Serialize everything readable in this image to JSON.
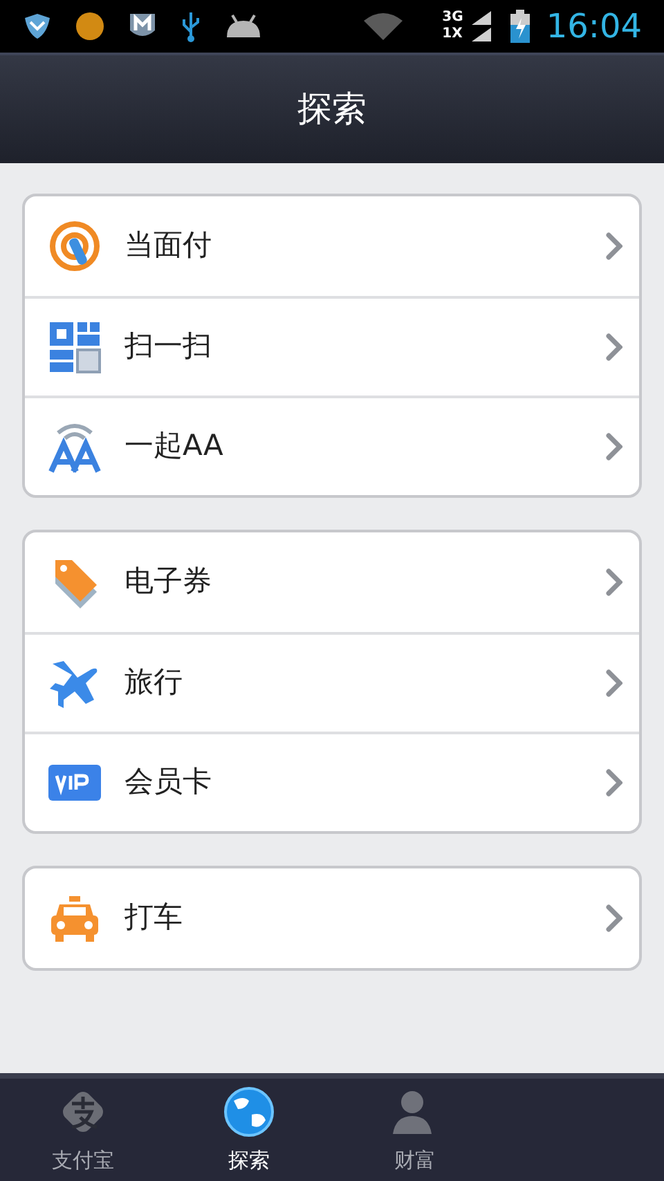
{
  "status_bar": {
    "network_top": "3G",
    "network_bottom": "1X",
    "time": "16:04"
  },
  "header": {
    "title": "探索"
  },
  "groups": [
    {
      "items": [
        {
          "label": "当面付"
        },
        {
          "label": "扫一扫"
        },
        {
          "label": "一起AA"
        }
      ]
    },
    {
      "items": [
        {
          "label": "电子券"
        },
        {
          "label": "旅行"
        },
        {
          "label": "会员卡"
        }
      ]
    },
    {
      "items": [
        {
          "label": "打车"
        }
      ]
    }
  ],
  "tab_bar": [
    {
      "label": "支付宝",
      "selected": false
    },
    {
      "label": "探索",
      "selected": true
    },
    {
      "label": "财富",
      "selected": false
    }
  ]
}
